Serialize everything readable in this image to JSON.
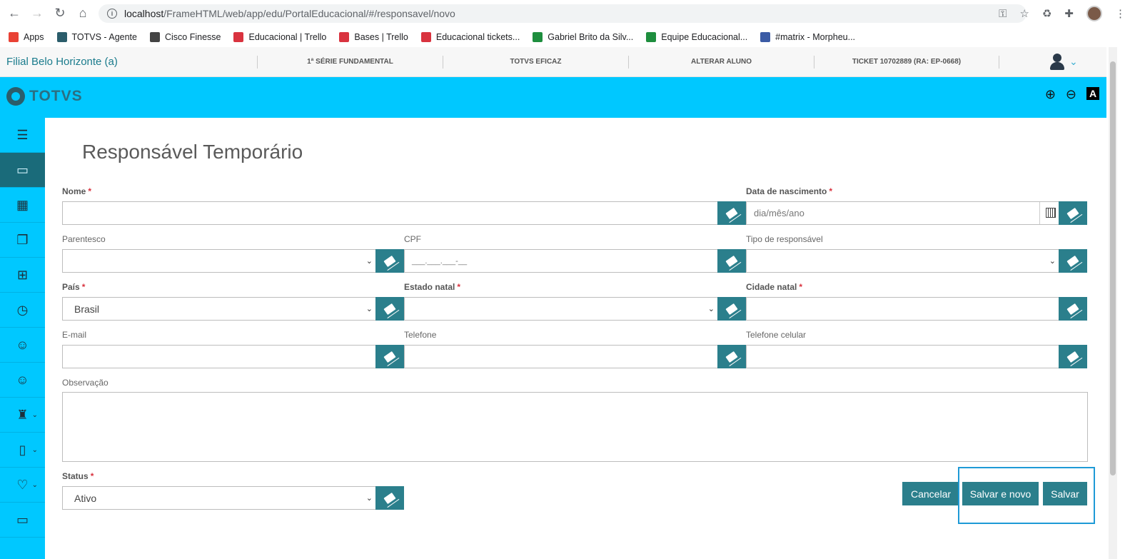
{
  "browser": {
    "url_host": "localhost",
    "url_path": "/FrameHTML/web/app/edu/PortalEducacional/#/responsavel/novo",
    "bookmarks": [
      {
        "label": "Apps",
        "color": "#e94235"
      },
      {
        "label": "TOTVS - Agente",
        "color": "#2b5d6b"
      },
      {
        "label": "Cisco Finesse",
        "color": "#444444"
      },
      {
        "label": "Educacional | Trello",
        "color": "#d9333f"
      },
      {
        "label": "Bases | Trello",
        "color": "#d9333f"
      },
      {
        "label": "Educacional tickets...",
        "color": "#d9333f"
      },
      {
        "label": "Gabriel Brito da Silv...",
        "color": "#1e8e3e"
      },
      {
        "label": "Equipe Educacional...",
        "color": "#1e8e3e"
      },
      {
        "label": "#matrix - Morpheu...",
        "color": "#3b5ba5"
      }
    ]
  },
  "context_bar": {
    "branch": "Filial Belo Horizonte (a)",
    "items": [
      "1ª SÉRIE FUNDAMENTAL",
      "TOTVS EFICAZ",
      "ALTERAR ALUNO",
      "TICKET 10702889 (RA: EP-0668)"
    ]
  },
  "topbar": {
    "logo": "TOTVS",
    "a11y_label": "A"
  },
  "page": {
    "title": "Responsável Temporário"
  },
  "form": {
    "required_mark": "*",
    "nome": {
      "label": "Nome"
    },
    "data_nascimento": {
      "label": "Data de nascimento",
      "placeholder": "dia/mês/ano"
    },
    "parentesco": {
      "label": "Parentesco",
      "value": ""
    },
    "cpf": {
      "label": "CPF",
      "placeholder": "___.___.___-__"
    },
    "tipo_responsavel": {
      "label": "Tipo de responsável",
      "value": ""
    },
    "pais": {
      "label": "País",
      "value": "Brasil"
    },
    "estado_natal": {
      "label": "Estado natal",
      "value": ""
    },
    "cidade_natal": {
      "label": "Cidade natal"
    },
    "email": {
      "label": "E-mail"
    },
    "telefone": {
      "label": "Telefone"
    },
    "telefone_celular": {
      "label": "Telefone celular"
    },
    "observacao": {
      "label": "Observação"
    },
    "status": {
      "label": "Status",
      "value": "Ativo"
    }
  },
  "actions": {
    "cancel": "Cancelar",
    "save_new": "Salvar e novo",
    "save": "Salvar"
  },
  "colors": {
    "accent": "#2b7f8c",
    "topbar": "#00c8ff",
    "highlight": "#1e9ad6"
  }
}
